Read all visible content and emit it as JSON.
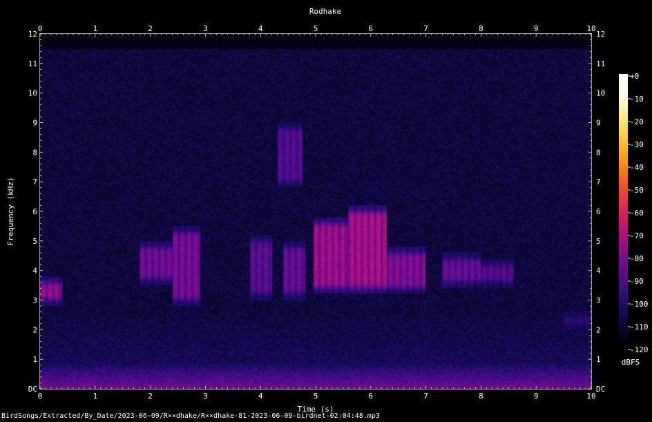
{
  "chart_data": {
    "type": "heatmap",
    "title": "Rodhake",
    "xlabel": "Time (s)",
    "ylabel": "Frequency (kHz)",
    "xlim": [
      0,
      10
    ],
    "ylim": [
      0,
      12
    ],
    "x_ticks": [
      "0",
      "1",
      "2",
      "3",
      "4",
      "5",
      "6",
      "7",
      "8",
      "9",
      "10"
    ],
    "y_ticks": [
      "DC",
      "1",
      "2",
      "3",
      "4",
      "5",
      "6",
      "7",
      "8",
      "9",
      "10",
      "11",
      "12"
    ],
    "colorbar": {
      "label": "dBFS",
      "range": [
        -120,
        0
      ],
      "ticks": [
        "+0",
        "-10",
        "-20",
        "-30",
        "-40",
        "-50",
        "-60",
        "-70",
        "-80",
        "-90",
        "-100",
        "-110",
        "-120"
      ],
      "colors": [
        "#000000",
        "#0a0630",
        "#1e0c6b",
        "#4a0c8a",
        "#7a0c90",
        "#b0107a",
        "#e0205a",
        "#f24a2a",
        "#fb8a10",
        "#fdc020",
        "#fde870",
        "#fffde0",
        "#ffffff"
      ]
    },
    "noise_floor_dbfs": -108,
    "cutoff_khz": 11.5,
    "features": [
      {
        "t_start": 0.0,
        "t_end": 0.4,
        "f_low": 2.8,
        "f_high": 3.8,
        "dbfs": -72
      },
      {
        "t_start": 1.8,
        "t_end": 2.5,
        "f_low": 3.5,
        "f_high": 5.0,
        "dbfs": -80
      },
      {
        "t_start": 2.4,
        "t_end": 2.9,
        "f_low": 2.8,
        "f_high": 5.5,
        "dbfs": -78
      },
      {
        "t_start": 3.8,
        "t_end": 4.2,
        "f_low": 3.0,
        "f_high": 5.2,
        "dbfs": -84
      },
      {
        "t_start": 4.3,
        "t_end": 4.75,
        "f_low": 6.8,
        "f_high": 9.0,
        "dbfs": -86
      },
      {
        "t_start": 4.4,
        "t_end": 4.8,
        "f_low": 3.0,
        "f_high": 5.0,
        "dbfs": -82
      },
      {
        "t_start": 4.95,
        "t_end": 5.6,
        "f_low": 3.2,
        "f_high": 5.8,
        "dbfs": -70
      },
      {
        "t_start": 5.6,
        "t_end": 6.3,
        "f_low": 3.2,
        "f_high": 6.2,
        "dbfs": -68
      },
      {
        "t_start": 6.3,
        "t_end": 7.0,
        "f_low": 3.2,
        "f_high": 4.8,
        "dbfs": -76
      },
      {
        "t_start": 7.3,
        "t_end": 8.0,
        "f_low": 3.4,
        "f_high": 4.6,
        "dbfs": -82
      },
      {
        "t_start": 8.0,
        "t_end": 8.6,
        "f_low": 3.4,
        "f_high": 4.4,
        "dbfs": -86
      },
      {
        "t_start": 9.5,
        "t_end": 10.0,
        "f_low": 2.0,
        "f_high": 2.6,
        "dbfs": -92
      }
    ]
  },
  "footer": {
    "path": "BirdSongs/Extracted/By_Date/2023-06-09/R××dhake/R××dhake-81-2023-06-09-birdnet-02:04:48.mp3"
  }
}
